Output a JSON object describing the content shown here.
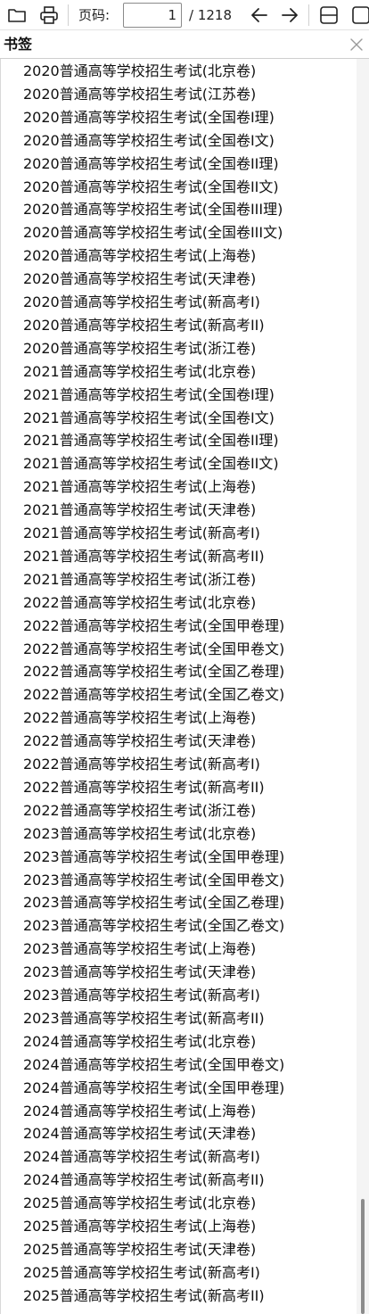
{
  "toolbar": {
    "folder_icon": "folder-icon",
    "print_icon": "print-icon",
    "page_label": "页码:",
    "page_value": "1",
    "page_total": "/ 1218",
    "prev_icon": "arrow-left-icon",
    "next_icon": "arrow-right-icon",
    "fit_icon": "page-fit-icon",
    "view_icon": "page-view-icon"
  },
  "bookmarks": {
    "title": "书签",
    "close_icon": "close-icon",
    "items": [
      "2020普通高等学校招生考试(北京卷)",
      "2020普通高等学校招生考试(江苏卷)",
      "2020普通高等学校招生考试(全国卷I理)",
      "2020普通高等学校招生考试(全国卷I文)",
      "2020普通高等学校招生考试(全国卷II理)",
      "2020普通高等学校招生考试(全国卷II文)",
      "2020普通高等学校招生考试(全国卷III理)",
      "2020普通高等学校招生考试(全国卷III文)",
      "2020普通高等学校招生考试(上海卷)",
      "2020普通高等学校招生考试(天津卷)",
      "2020普通高等学校招生考试(新高考I)",
      "2020普通高等学校招生考试(新高考II)",
      "2020普通高等学校招生考试(浙江卷)",
      "2021普通高等学校招生考试(北京卷)",
      "2021普通高等学校招生考试(全国卷I理)",
      "2021普通高等学校招生考试(全国卷I文)",
      "2021普通高等学校招生考试(全国卷II理)",
      "2021普通高等学校招生考试(全国卷II文)",
      "2021普通高等学校招生考试(上海卷)",
      "2021普通高等学校招生考试(天津卷)",
      "2021普通高等学校招生考试(新高考I)",
      "2021普通高等学校招生考试(新高考II)",
      "2021普通高等学校招生考试(浙江卷)",
      "2022普通高等学校招生考试(北京卷)",
      "2022普通高等学校招生考试(全国甲卷理)",
      "2022普通高等学校招生考试(全国甲卷文)",
      "2022普通高等学校招生考试(全国乙卷理)",
      "2022普通高等学校招生考试(全国乙卷文)",
      "2022普通高等学校招生考试(上海卷)",
      "2022普通高等学校招生考试(天津卷)",
      "2022普通高等学校招生考试(新高考I)",
      "2022普通高等学校招生考试(新高考II)",
      "2022普通高等学校招生考试(浙江卷)",
      "2023普通高等学校招生考试(北京卷)",
      "2023普通高等学校招生考试(全国甲卷理)",
      "2023普通高等学校招生考试(全国甲卷文)",
      "2023普通高等学校招生考试(全国乙卷理)",
      "2023普通高等学校招生考试(全国乙卷文)",
      "2023普通高等学校招生考试(上海卷)",
      "2023普通高等学校招生考试(天津卷)",
      "2023普通高等学校招生考试(新高考I)",
      "2023普通高等学校招生考试(新高考II)",
      "2024普通高等学校招生考试(北京卷)",
      "2024普通高等学校招生考试(全国甲卷文)",
      "2024普通高等学校招生考试(全国甲卷理)",
      "2024普通高等学校招生考试(上海卷)",
      "2024普通高等学校招生考试(天津卷)",
      "2024普通高等学校招生考试(新高考I)",
      "2024普通高等学校招生考试(新高考II)",
      "2025普通高等学校招生考试(北京卷)",
      "2025普通高等学校招生考试(上海卷)",
      "2025普通高等学校招生考试(天津卷)",
      "2025普通高等学校招生考试(新高考I)",
      "2025普通高等学校招生考试(新高考II)"
    ]
  }
}
